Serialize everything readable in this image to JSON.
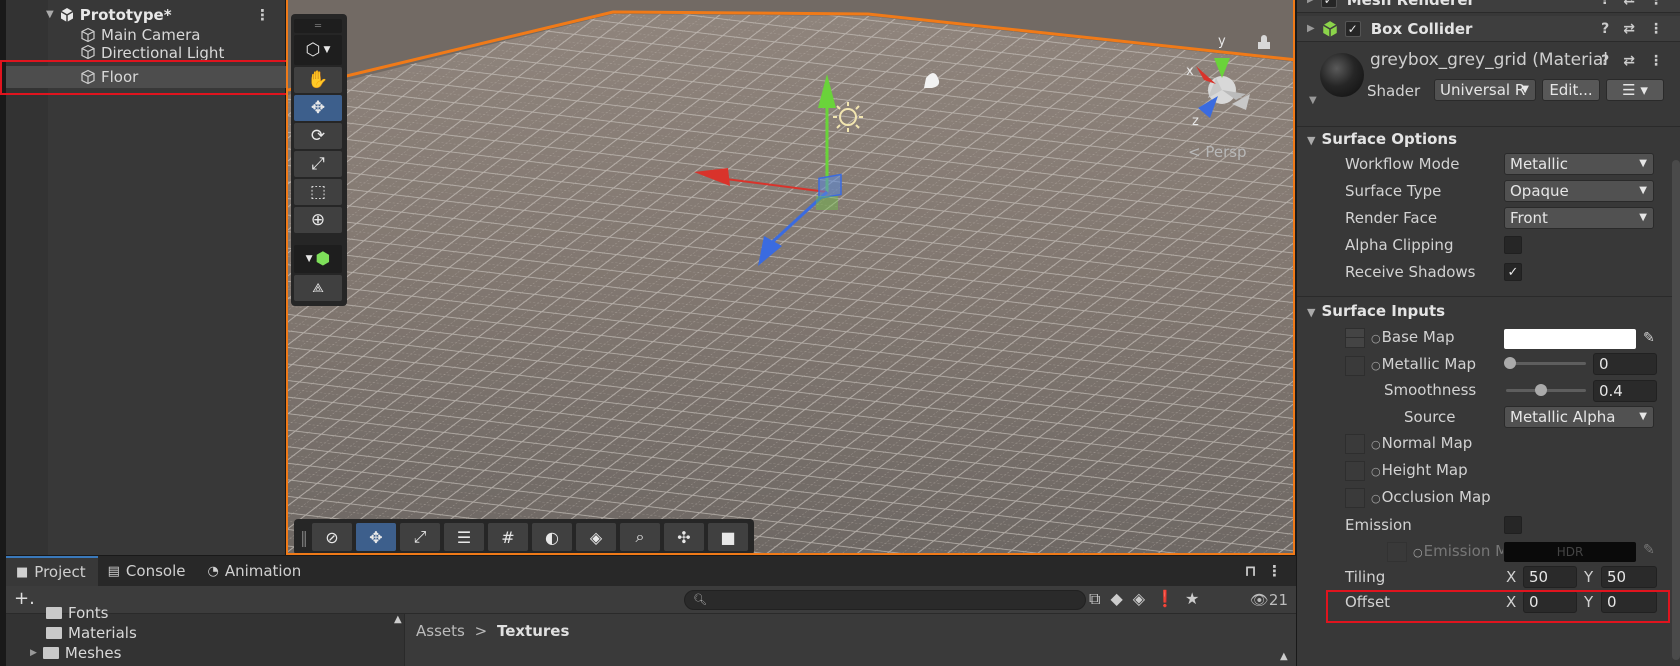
{
  "hierarchy": {
    "scene_name": "Prototype*",
    "items": [
      {
        "label": "Main Camera"
      },
      {
        "label": "Directional Light"
      },
      {
        "label": "Floor"
      }
    ]
  },
  "scene": {
    "persp_label": "< Persp",
    "gizmo_axes": {
      "x": "x",
      "y": "y",
      "z": "z"
    }
  },
  "inspector": {
    "components": [
      {
        "name": "Mesh Renderer"
      },
      {
        "name": "Box Collider"
      }
    ],
    "material": {
      "title": "greybox_grey_grid (Material",
      "shader_label": "Shader",
      "shader_value": "Universal R",
      "edit_button": "Edit..."
    },
    "surface_options": {
      "header": "Surface Options",
      "workflow_mode": {
        "label": "Workflow Mode",
        "value": "Metallic"
      },
      "surface_type": {
        "label": "Surface Type",
        "value": "Opaque"
      },
      "render_face": {
        "label": "Render Face",
        "value": "Front"
      },
      "alpha_clipping": {
        "label": "Alpha Clipping",
        "checked": false
      },
      "receive_shadows": {
        "label": "Receive Shadows",
        "checked": true,
        "mark": "✓"
      }
    },
    "surface_inputs": {
      "header": "Surface Inputs",
      "base_map": "Base Map",
      "metallic_map": {
        "label": "Metallic Map",
        "value": "0",
        "slider": 0
      },
      "smoothness": {
        "label": "Smoothness",
        "value": "0.4",
        "slider": 0.4
      },
      "source": {
        "label": "Source",
        "value": "Metallic Alpha"
      },
      "normal_map": "Normal Map",
      "height_map": "Height Map",
      "occlusion_map": "Occlusion Map",
      "emission": {
        "label": "Emission",
        "sub_label": "Emission M",
        "hdr": "HDR"
      },
      "tiling": {
        "label": "Tiling",
        "x_label": "X",
        "x": "50",
        "y_label": "Y",
        "y": "50"
      },
      "offset": {
        "label": "Offset",
        "x_label": "X",
        "x": "0",
        "y_label": "Y",
        "y": "0"
      }
    }
  },
  "bottom": {
    "tabs": [
      {
        "label": "Project",
        "icon": "folder-icon"
      },
      {
        "label": "Console",
        "icon": "console-icon"
      },
      {
        "label": "Animation",
        "icon": "animation-icon"
      }
    ],
    "add_button": "+.",
    "hidden_count": "21",
    "tree": [
      {
        "label": "Fonts"
      },
      {
        "label": "Materials"
      },
      {
        "label": "Meshes"
      }
    ],
    "breadcrumb": {
      "root": "Assets",
      "sep": ">",
      "current": "Textures"
    }
  },
  "colors": {
    "accent_orange": "#f07a18",
    "highlight_red": "#e0141e",
    "selection_blue": "#3d5f8c",
    "axis_x": "#d9332b",
    "axis_y": "#6ad33a",
    "axis_z": "#3a6be0"
  }
}
